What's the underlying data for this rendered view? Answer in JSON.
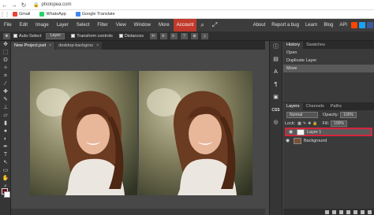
{
  "browser": {
    "url": "photopea.com",
    "bookmarks": [
      {
        "label": "Gmail",
        "color": "#ea4335"
      },
      {
        "label": "WhatsApp",
        "color": "#25d366"
      },
      {
        "label": "Google Translate",
        "color": "#4285f4"
      }
    ]
  },
  "menubar": {
    "items": [
      "File",
      "Edit",
      "Image",
      "Layer",
      "Select",
      "Filter",
      "View",
      "Window",
      "More"
    ],
    "account": "Account",
    "right": [
      "About",
      "Report a bug",
      "Learn",
      "Blog",
      "API"
    ],
    "account_color": "#c0392b"
  },
  "options": {
    "auto_select": "Auto-Select",
    "auto_select_target": "Layer",
    "transform_controls": "Transform controls",
    "distances": "Distances"
  },
  "tabs": [
    {
      "label": "New Project.psd",
      "close": "×"
    },
    {
      "label": "desktop-backgrou",
      "close": "×"
    }
  ],
  "side_icons": {
    "css_label": "CSS"
  },
  "history": {
    "tabs": [
      "History",
      "Swatches"
    ],
    "entries": [
      "Open",
      "Duplicate Layer",
      "Move"
    ],
    "selected_index": 2
  },
  "layers": {
    "tabs": [
      "Layers",
      "Channels",
      "Paths"
    ],
    "blend_mode": "Normal",
    "opacity_label": "Opacity:",
    "opacity_value": "100%",
    "lock_label": "Lock:",
    "fill_label": "Fill:",
    "fill_value": "100%",
    "items": [
      {
        "name": "Layer 1",
        "selected": true,
        "highlight_color": "#d7263d"
      },
      {
        "name": "Background",
        "selected": false
      }
    ]
  },
  "colors": {
    "foreground": "#6b0f1a",
    "background": "#ffffff"
  }
}
